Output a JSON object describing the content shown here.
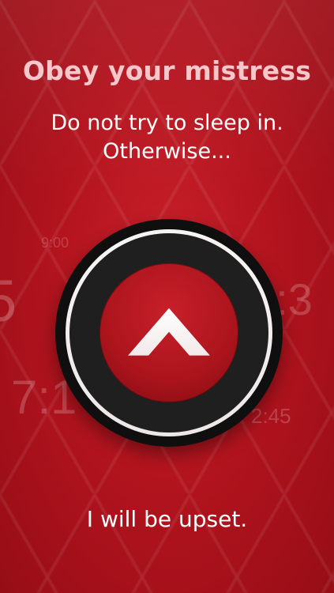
{
  "title": "Obey your mistress",
  "subtitle": {
    "line1": "Do not try to sleep in.",
    "line2": "Otherwise..."
  },
  "background_times": [
    "9:00",
    "5",
    "2:3",
    "7:1",
    "2:45"
  ],
  "button": {
    "icon": "chevron-up-icon"
  },
  "bottom_text": "I will be upset.",
  "colors": {
    "background": "#b3141e",
    "title": "#f7c7cb",
    "text": "#ffffff",
    "dial_outer": "#0f0f10",
    "dial_ring": "#ffffff",
    "button": "#c8202a"
  }
}
